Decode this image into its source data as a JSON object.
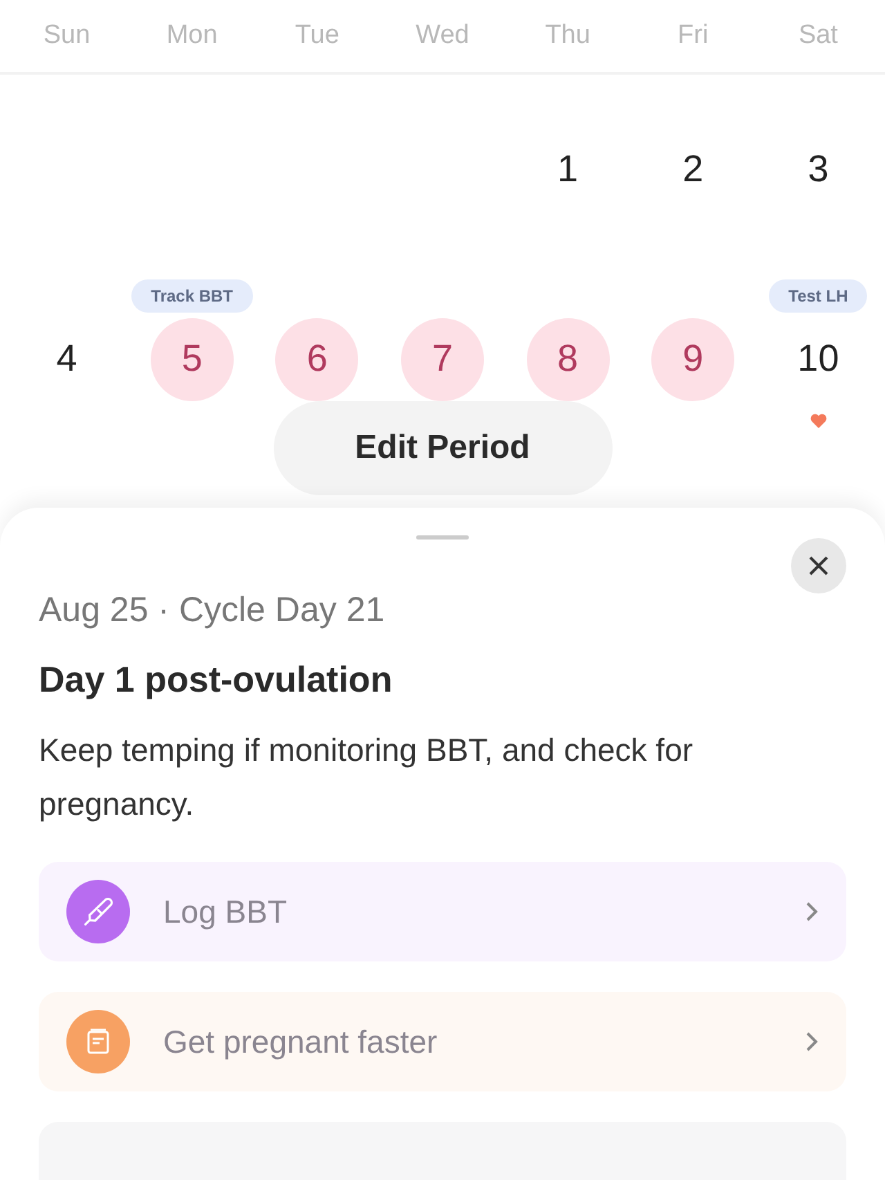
{
  "weekdays": [
    "Sun",
    "Mon",
    "Tue",
    "Wed",
    "Thu",
    "Fri",
    "Sat"
  ],
  "weeks": [
    [
      {
        "day": "1",
        "period": false
      },
      {
        "day": "2",
        "period": false
      },
      {
        "day": "3",
        "period": false
      }
    ],
    [
      {
        "day": "4",
        "period": false
      },
      {
        "day": "5",
        "period": true,
        "tag": "Track BBT"
      },
      {
        "day": "6",
        "period": true
      },
      {
        "day": "7",
        "period": true
      },
      {
        "day": "8",
        "period": true
      },
      {
        "day": "9",
        "period": true
      },
      {
        "day": "10",
        "period": false,
        "tag": "Test LH",
        "heart": true
      }
    ]
  ],
  "edit_button": "Edit Period",
  "sheet": {
    "date": "Aug 25 · Cycle Day 21",
    "title": "Day 1 post-ovulation",
    "description": "Keep temping if monitoring BBT, and check for pregnancy.",
    "actions": [
      {
        "kind": "thermometer",
        "label": "Log BBT",
        "color": "#b86cf0"
      },
      {
        "kind": "book",
        "label": "Get pregnant faster",
        "color": "#f7a163"
      }
    ]
  }
}
